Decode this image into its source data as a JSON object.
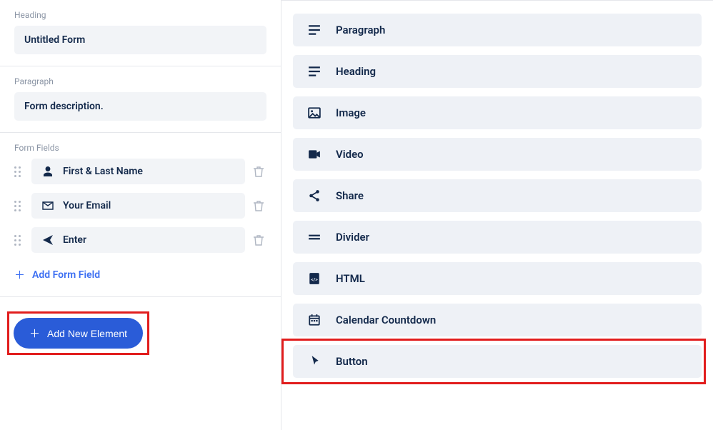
{
  "left": {
    "heading_label": "Heading",
    "heading_value": "Untitled Form",
    "paragraph_label": "Paragraph",
    "paragraph_value": "Form description.",
    "form_fields_label": "Form Fields",
    "fields": [
      {
        "icon": "user",
        "label": "First & Last Name"
      },
      {
        "icon": "envelope",
        "label": "Your Email"
      },
      {
        "icon": "send",
        "label": "Enter"
      }
    ],
    "add_form_field_label": "Add Form Field",
    "add_new_element_label": "Add New Element"
  },
  "right": {
    "elements": [
      {
        "icon": "paragraph",
        "label": "Paragraph"
      },
      {
        "icon": "paragraph",
        "label": "Heading"
      },
      {
        "icon": "image",
        "label": "Image"
      },
      {
        "icon": "video",
        "label": "Video"
      },
      {
        "icon": "share",
        "label": "Share"
      },
      {
        "icon": "divider",
        "label": "Divider"
      },
      {
        "icon": "html",
        "label": "HTML"
      },
      {
        "icon": "calendar",
        "label": "Calendar Countdown"
      },
      {
        "icon": "pointer",
        "label": "Button"
      }
    ],
    "highlighted_index": 8
  }
}
